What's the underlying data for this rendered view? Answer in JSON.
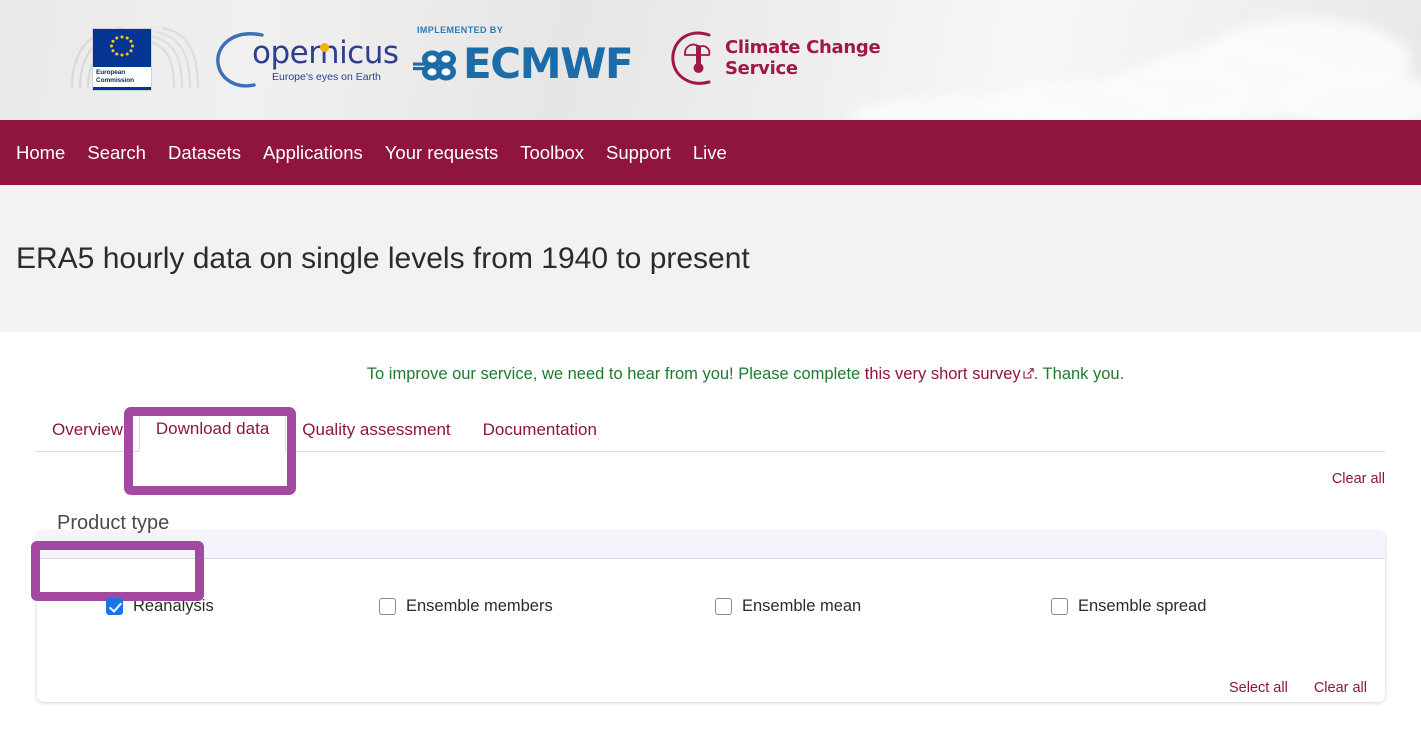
{
  "banner": {
    "eu": {
      "label_line1": "European",
      "label_line2": "Commission",
      "name": "eu-commission-logo"
    },
    "copernicus": {
      "wordmark": "opernicus",
      "tagline": "Europe's eyes on Earth"
    },
    "ecmwf": {
      "implemented_by": "IMPLEMENTED BY",
      "wordmark": "ECMWF"
    },
    "c3s": {
      "line1": "Climate Change",
      "line2": "Service"
    }
  },
  "nav": {
    "items": [
      {
        "label": "Home"
      },
      {
        "label": "Search"
      },
      {
        "label": "Datasets"
      },
      {
        "label": "Applications"
      },
      {
        "label": "Your requests"
      },
      {
        "label": "Toolbox"
      },
      {
        "label": "Support"
      },
      {
        "label": "Live"
      }
    ]
  },
  "page": {
    "title": "ERA5 hourly data on single levels from 1940 to present"
  },
  "survey": {
    "text_before": "To improve our service, we need to hear from you! Please complete ",
    "link_text": "this very short survey",
    "text_after": ". Thank you.",
    "color_green": "#1f7a2e",
    "color_link": "#8f1440"
  },
  "tabs": {
    "items": [
      {
        "label": "Overview",
        "active": false
      },
      {
        "label": "Download data",
        "active": true
      },
      {
        "label": "Quality assessment",
        "active": false
      },
      {
        "label": "Documentation",
        "active": false
      }
    ]
  },
  "toolbar": {
    "clear_all_label": "Clear all"
  },
  "product_type": {
    "header": "Product type",
    "options": [
      {
        "label": "Reanalysis",
        "checked": true
      },
      {
        "label": "Ensemble members",
        "checked": false
      },
      {
        "label": "Ensemble mean",
        "checked": false
      },
      {
        "label": "Ensemble spread",
        "checked": false
      }
    ],
    "select_all_label": "Select all",
    "clear_all_label": "Clear all"
  },
  "annotations": {
    "color": "#a3499f",
    "targets": [
      "download-data-tab",
      "product-type-header"
    ]
  },
  "colors": {
    "nav_bar": "#8f1440",
    "link": "#8f1440",
    "checkbox_checked": "#1a73e8",
    "panel_header": "#f4f4fc",
    "title_band": "#f2f2f2"
  }
}
